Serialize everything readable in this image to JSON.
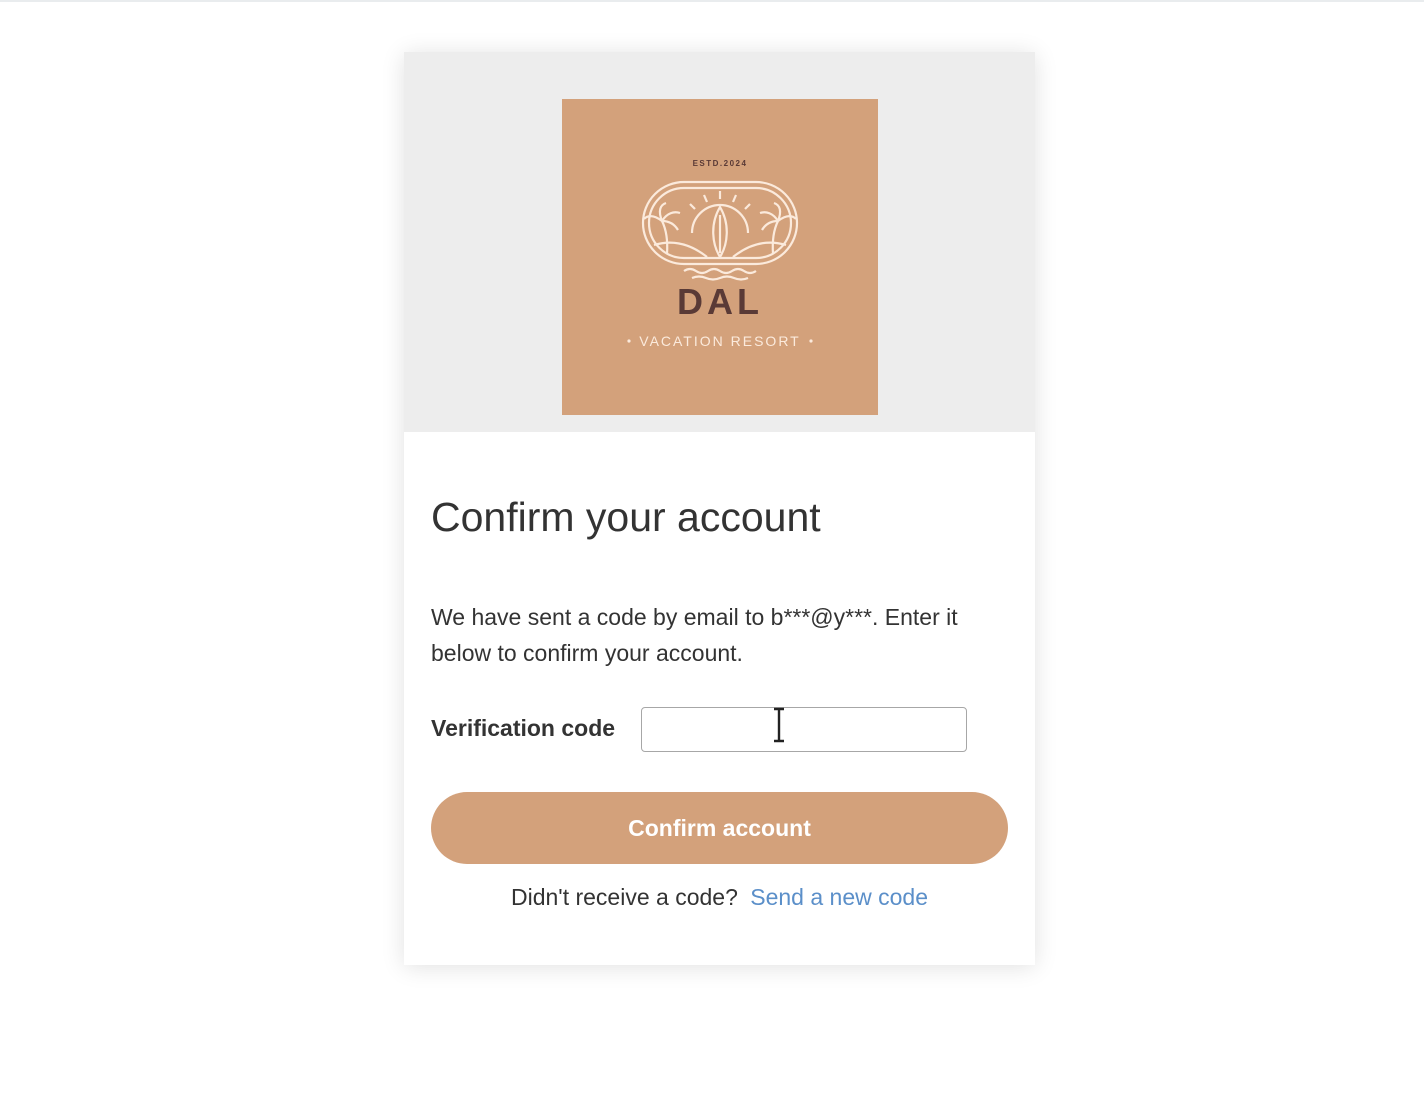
{
  "logo": {
    "established": "ESTD.2024",
    "name": "DAL",
    "subtitle": "VACATION RESORT",
    "background_color": "#d3a17b",
    "line_color": "#fbeadc",
    "name_color": "#5a3a36"
  },
  "form": {
    "title": "Confirm your account",
    "description": "We have sent a code by email to b***@y***. Enter it below to confirm your account.",
    "code_label": "Verification code",
    "code_value": "",
    "confirm_label": "Confirm account",
    "resend_prompt": "Didn't receive a code?",
    "resend_link": "Send a new code"
  },
  "colors": {
    "accent": "#d3a17b",
    "link": "#5b8fc9",
    "text": "#333333",
    "banner": "#ededed"
  },
  "icons": {
    "cursor": "text-cursor-icon"
  }
}
